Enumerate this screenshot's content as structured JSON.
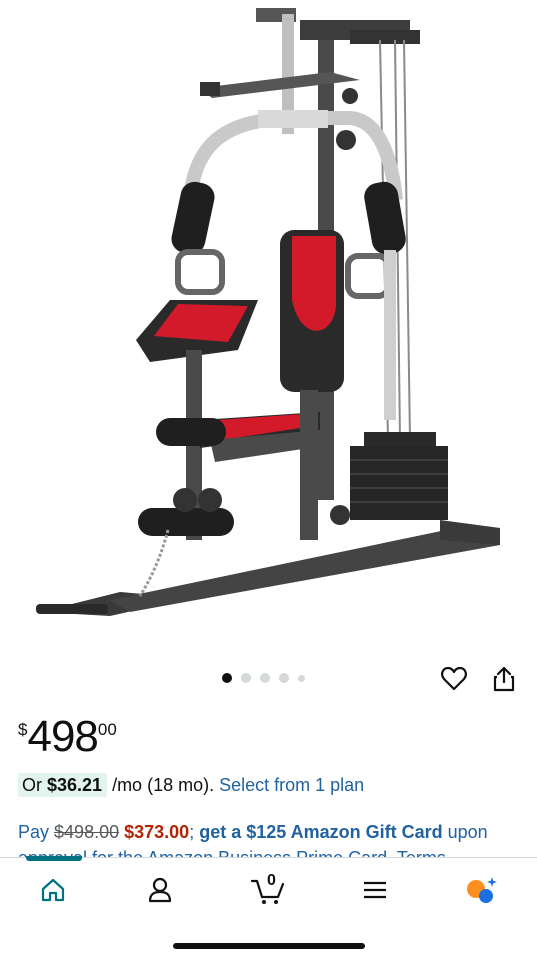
{
  "product": {
    "image_alt": "home gym machine",
    "carousel": {
      "count": 5,
      "active_index": 0
    }
  },
  "price": {
    "currency": "$",
    "whole": "498",
    "fraction": "00"
  },
  "installment": {
    "prefix": "Or ",
    "amount": "$36.21",
    "suffix": " /mo (18 mo). ",
    "link": "Select from 1 plan"
  },
  "card_offer": {
    "pay": "Pay ",
    "original_price": "$498.00",
    "sale_price": "$373.00",
    "separator": "; ",
    "gift_card": "get a $125 Amazon Gift Card",
    "tail": " upon",
    "line2": "approval for the Amazon Business Prime Card. Terms"
  },
  "nav": {
    "cart_count": "0",
    "items": [
      "home-icon",
      "account-icon",
      "cart-icon",
      "menu-icon",
      "ai-assistant-icon"
    ]
  },
  "colors": {
    "link": "#2162a1",
    "sale": "#b12704",
    "teal": "#007185",
    "pill": "#e3f4ee"
  }
}
